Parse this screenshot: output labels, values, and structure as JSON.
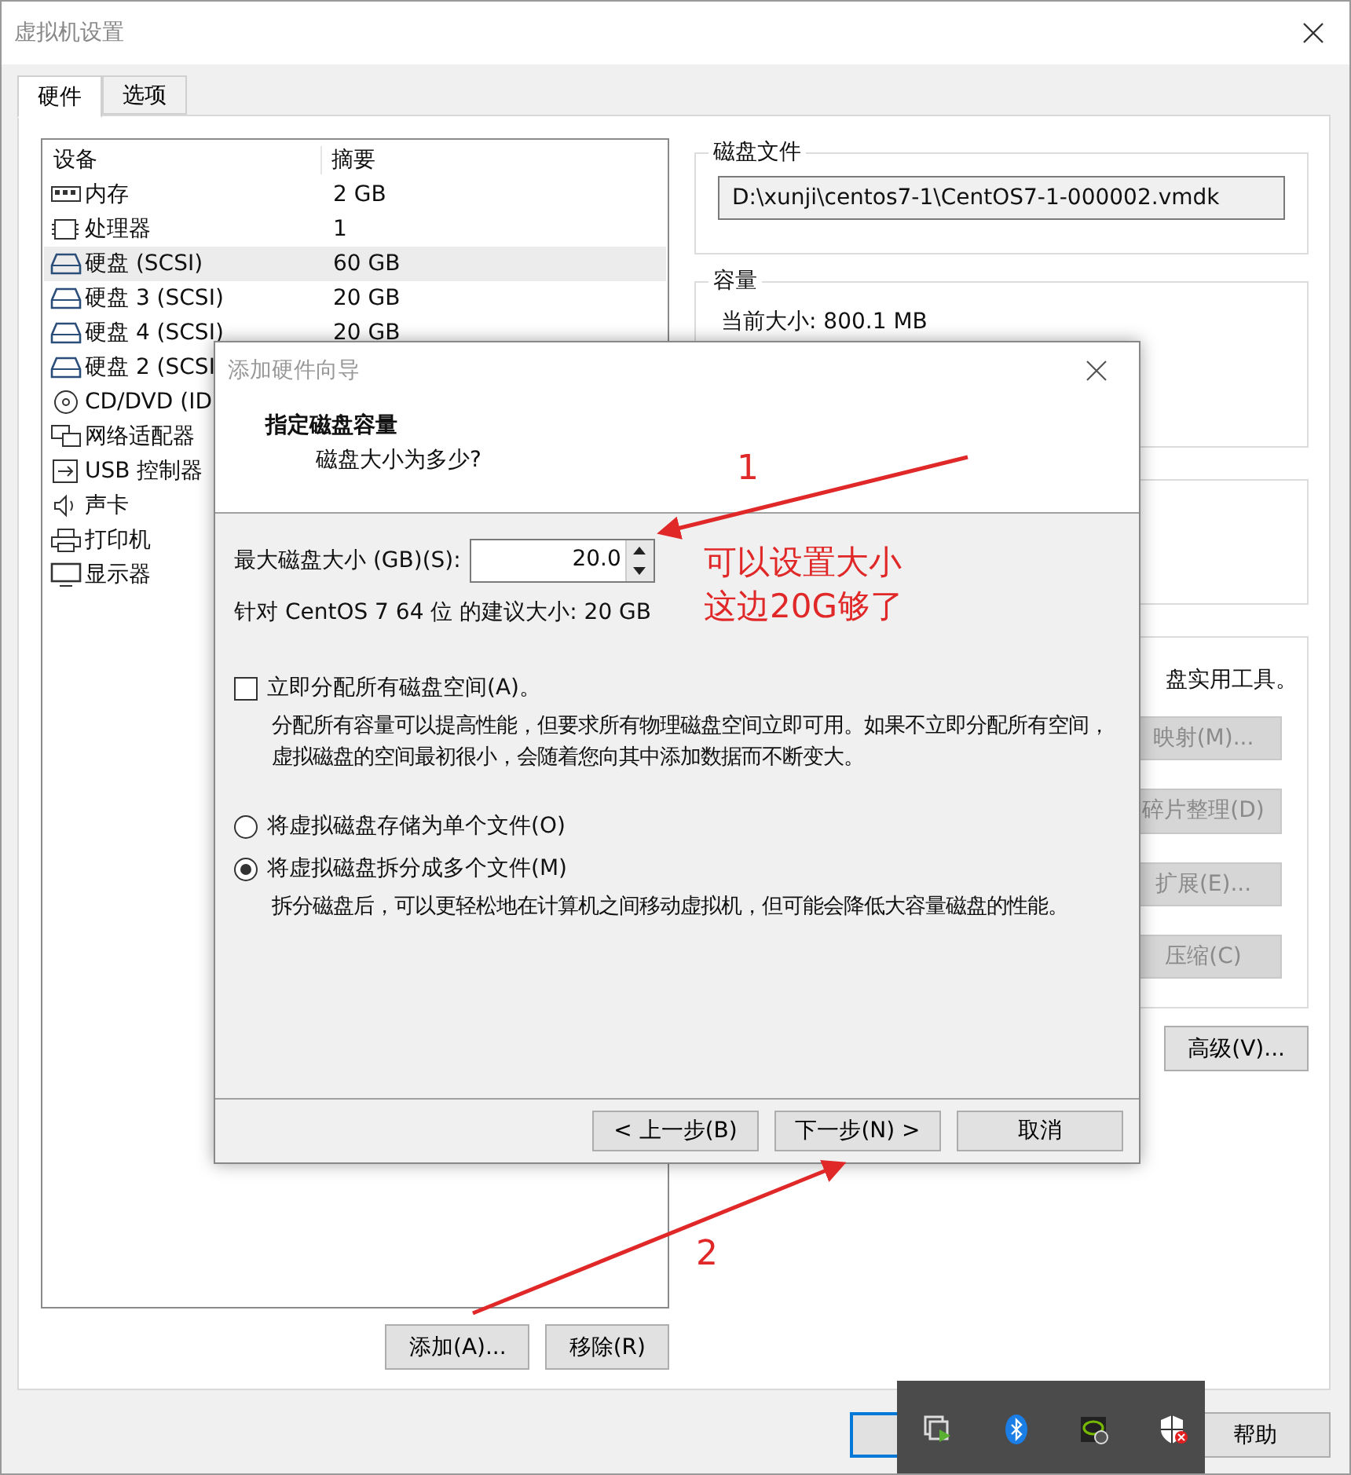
{
  "window": {
    "title": "虚拟机设置"
  },
  "tabs": [
    {
      "label": "硬件",
      "selected": true
    },
    {
      "label": "选项",
      "selected": false
    }
  ],
  "devices": {
    "columns": [
      "设备",
      "摘要"
    ],
    "rows": [
      {
        "kind": "memory",
        "name": "内存",
        "summary": "2 GB",
        "selected": false
      },
      {
        "kind": "cpu",
        "name": "处理器",
        "summary": "1",
        "selected": false
      },
      {
        "kind": "disk",
        "name": "硬盘 (SCSI)",
        "summary": "60 GB",
        "selected": true
      },
      {
        "kind": "disk",
        "name": "硬盘 3 (SCSI)",
        "summary": "20 GB",
        "selected": false
      },
      {
        "kind": "disk",
        "name": "硬盘 4 (SCSI)",
        "summary": "20 GB",
        "selected": false
      },
      {
        "kind": "disk",
        "name": "硬盘 2 (SCSI",
        "selected": false
      },
      {
        "kind": "cdrom",
        "name": "CD/DVD (ID",
        "selected": false
      },
      {
        "kind": "network",
        "name": "网络适配器",
        "selected": false
      },
      {
        "kind": "usb",
        "name": "USB 控制器",
        "selected": false
      },
      {
        "kind": "sound",
        "name": "声卡",
        "selected": false
      },
      {
        "kind": "printer",
        "name": "打印机",
        "selected": false
      },
      {
        "kind": "display",
        "name": "显示器",
        "selected": false
      }
    ]
  },
  "device_buttons": [
    "添加(A)...",
    "移除(R)"
  ],
  "disk_file": {
    "title": "磁盘文件",
    "path": "D:\\xunji\\centos7-1\\CentOS7-1-000002.vmdk"
  },
  "capacity": {
    "title": "容量",
    "current": "当前大小: 800.1 MB"
  },
  "utilities": {
    "text": "盘实用工具。",
    "buttons": [
      {
        "label": "映射(M)...",
        "disabled": true
      },
      {
        "label": "碎片整理(D)",
        "disabled": true
      },
      {
        "label": "扩展(E)...",
        "disabled": true
      },
      {
        "label": "压缩(C)",
        "disabled": true
      }
    ]
  },
  "advanced_button": "高级(V)...",
  "help_button": "帮助",
  "wizard": {
    "title": "添加硬件向导",
    "heading": "指定磁盘容量",
    "subheading": "磁盘大小为多少?",
    "size_label": "最大磁盘大小 (GB)(S):",
    "size_value": "20.0",
    "recommendation": "针对 CentOS 7 64 位 的建议大小: 20 GB",
    "allocate": {
      "label": "立即分配所有磁盘空间(A)。",
      "checked": false,
      "description": "分配所有容量可以提高性能，但要求所有物理磁盘空间立即可用。如果不立即分配所有空间，虚拟磁盘的空间最初很小，会随着您向其中添加数据而不断变大。"
    },
    "storage_options": [
      {
        "label": "将虚拟磁盘存储为单个文件(O)",
        "selected": false
      },
      {
        "label": "将虚拟磁盘拆分成多个文件(M)",
        "selected": true
      }
    ],
    "split_description": "拆分磁盘后，可以更轻松地在计算机之间移动虚拟机，但可能会降低大容量磁盘的性能。",
    "buttons": [
      "< 上一步(B)",
      "下一步(N) >",
      "取消"
    ]
  },
  "annotations": {
    "labels": [
      "1",
      "2"
    ],
    "note": [
      "可以设置大小",
      "这边20G够了"
    ]
  }
}
